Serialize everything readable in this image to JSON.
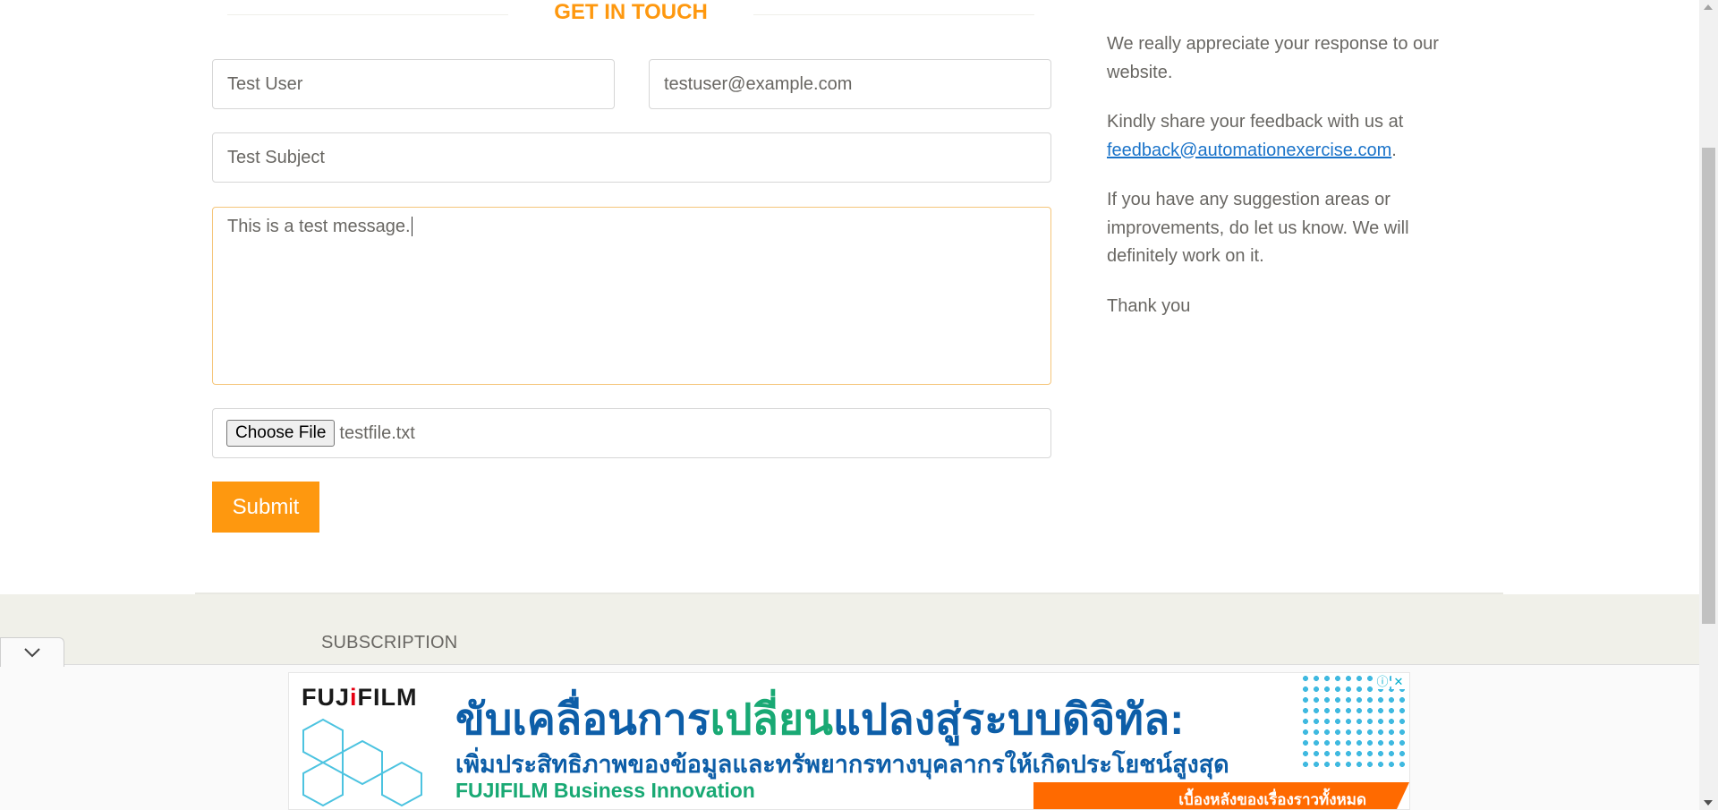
{
  "contact_form": {
    "heading": "GET IN TOUCH",
    "name_value": "Test User",
    "email_value": "testuser@example.com",
    "subject_value": "Test Subject",
    "message_value": "This is a test message.",
    "file_button_label": "Choose File",
    "file_name": "testfile.txt",
    "submit_label": "Submit"
  },
  "feedback": {
    "p1": "We really appreciate your response to our website.",
    "p2_prefix": "Kindly share your feedback with us at ",
    "p2_email": "feedback@automationexercise.com",
    "p2_suffix": ".",
    "p3": "If you have any suggestion areas or improvements, do let us know. We will definitely work on it.",
    "p4": "Thank you"
  },
  "footer": {
    "subscription_label": "SUBSCRIPTION"
  },
  "ad": {
    "brand_left": "FUJ",
    "brand_mark": "i",
    "brand_right": "FILM",
    "headline_a": "ขับเคลื่อนการ",
    "headline_b": "เปลี่ยน",
    "headline_c": "แปลงสู่ระบบดิจิทัล:",
    "subline": "เพิ่มประสิทธิภาพของข้อมูลและทรัพยากรทางบุคลากรให้เกิดประโยชน์สูงสุด",
    "company": "FUJIFILM Business Innovation",
    "cta": "เบื้องหลังของเรื่องราวทั้งหมด",
    "info_glyph": "ⓘ",
    "close_glyph": "✕"
  },
  "icons": {
    "collapse": "chevron-down-icon",
    "ad_info": "info-icon",
    "ad_close": "close-icon"
  },
  "colors": {
    "accent": "#fe980f",
    "link": "#1a73c9",
    "text": "#696763",
    "footer_bg": "#f0f0e9"
  }
}
